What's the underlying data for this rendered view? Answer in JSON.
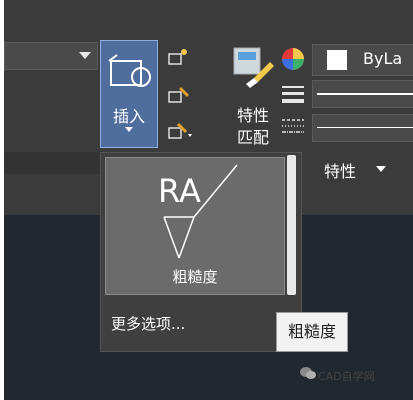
{
  "ribbon": {
    "insert_button": {
      "label": "插入"
    },
    "match_properties_button": {
      "label_line1": "特性",
      "label_line2": "匹配"
    },
    "color_combo": {
      "value": "ByLa"
    },
    "properties_panel": {
      "title": "特性"
    }
  },
  "dropdown": {
    "gallery_item": {
      "symbol_text": "RA",
      "label": "粗糙度"
    },
    "more_options": "更多选项...",
    "tooltip": "粗糙度"
  },
  "watermark_badge": {
    "text": "CAD自学网"
  },
  "colors": {
    "ribbon_bg": "#3b3b3b",
    "insert_highlight": "#4f6e9e",
    "gallery_item_bg": "#6b6b6b",
    "drawing_bg": "#212830"
  }
}
